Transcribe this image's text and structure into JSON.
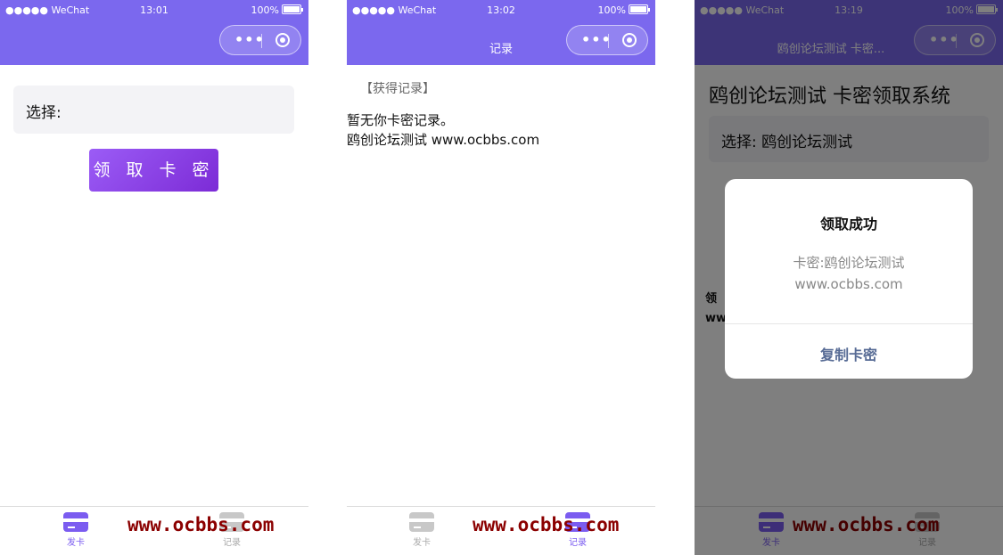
{
  "colors": {
    "accent": "#7b68ee",
    "button": "#8b3fe8",
    "watermark": "#8b0000",
    "modal_action": "#576b95"
  },
  "status": {
    "carrier": "●●●●● WeChat",
    "battery": "100%"
  },
  "screen1": {
    "time": "13:01",
    "nav_title": "",
    "select_label": "选择:",
    "claim_button": "领 取 卡 密",
    "tabs": [
      {
        "label": "发卡",
        "icon": "card-icon"
      },
      {
        "label": "记录",
        "icon": "record-icon"
      }
    ],
    "watermark": "www.ocbbs.com"
  },
  "screen2": {
    "time": "13:02",
    "nav_title": "记录",
    "heading": "【获得记录】",
    "line1": "暂无你卡密记录。",
    "line2": "鸥创论坛测试 www.ocbbs.com",
    "tabs": [
      {
        "label": "发卡",
        "icon": "card-icon"
      },
      {
        "label": "记录",
        "icon": "record-icon"
      }
    ],
    "watermark": "www.ocbbs.com"
  },
  "screen3": {
    "time": "13:19",
    "nav_title": "鸥创论坛测试 卡密...",
    "page_title": "鸥创论坛测试 卡密领取系统",
    "select_label": "选择: 鸥创论坛测试",
    "bg_line1": "领",
    "bg_line2": "ww",
    "modal": {
      "title": "领取成功",
      "content_line1": "卡密:鸥创论坛测试",
      "content_line2": "www.ocbbs.com",
      "action": "复制卡密"
    },
    "tabs": [
      {
        "label": "发卡",
        "icon": "card-icon"
      },
      {
        "label": "记录",
        "icon": "record-icon"
      }
    ],
    "watermark": "www.ocbbs.com"
  }
}
